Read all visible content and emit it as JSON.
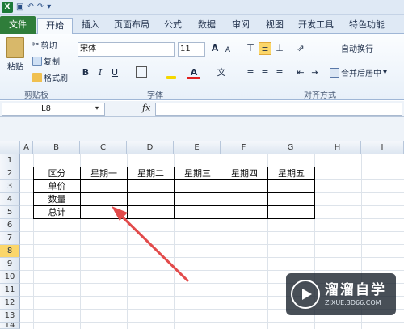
{
  "qat": {
    "app_icon": "X",
    "undo": "↶",
    "redo": "↷",
    "customize": "▾"
  },
  "tabs": [
    "文件",
    "开始",
    "插入",
    "页面布局",
    "公式",
    "数据",
    "审阅",
    "视图",
    "开发工具",
    "特色功能"
  ],
  "ribbon": {
    "clipboard": {
      "paste": "粘贴",
      "cut": "剪切",
      "copy": "复制",
      "format_painter": "格式刷",
      "label": "剪贴板"
    },
    "font": {
      "name": "宋体",
      "size": "11",
      "grow": "A",
      "shrink": "A",
      "bold": "B",
      "italic": "I",
      "underline": "U",
      "label": "字体"
    },
    "alignment": {
      "wrap": "自动换行",
      "merge": "合并后居中",
      "label": "对齐方式"
    },
    "colors": {
      "fill": "#f5d800",
      "font": "#e02020",
      "accent": "#2f7d3a"
    }
  },
  "formula_bar": {
    "name_box": "L8",
    "fx": "fx",
    "value": ""
  },
  "columns": [
    "A",
    "B",
    "C",
    "D",
    "E",
    "F",
    "G",
    "H",
    "I"
  ],
  "rows": [
    "1",
    "2",
    "3",
    "4",
    "5",
    "6",
    "7",
    "8",
    "9",
    "10",
    "11",
    "12",
    "13",
    "14"
  ],
  "table": {
    "header": [
      "区分",
      "星期一",
      "星期二",
      "星期三",
      "星期四",
      "星期五"
    ],
    "row_labels": [
      "单价",
      "数量",
      "总计"
    ]
  },
  "watermark": {
    "name": "溜溜自学",
    "url": "ZIXUE.3D66.COM"
  }
}
